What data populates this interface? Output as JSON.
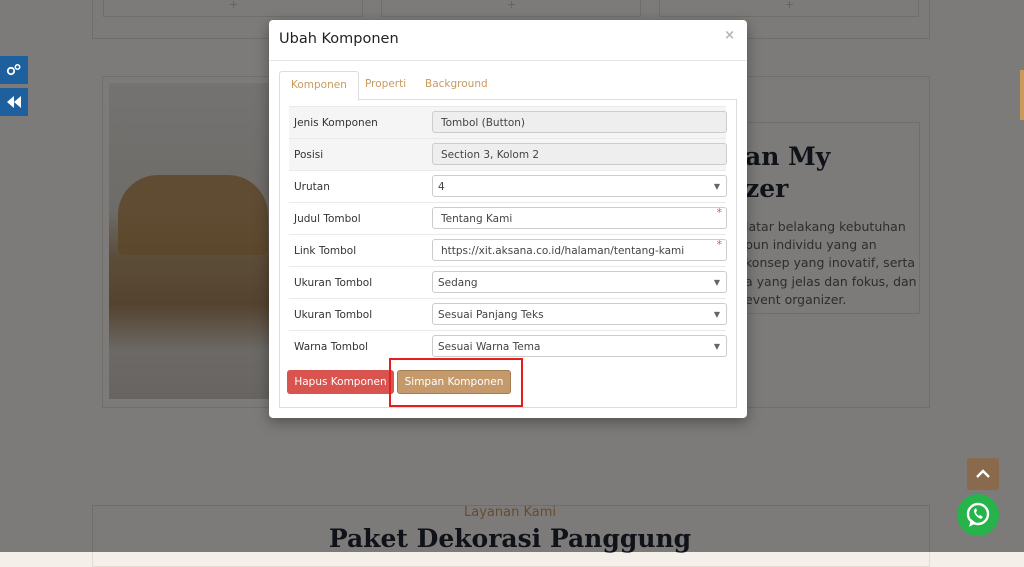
{
  "background": {
    "heading_line1": "an My",
    "heading_line2": "zer",
    "paragraph": "latar belakang kebutuhan pun individu yang an konsep yang inovatif, serta a yang jelas dan fokus, dan event organizer.",
    "section_subtitle": "Layanan Kami",
    "section_title": "Paket Dekorasi Panggung"
  },
  "modal": {
    "title": "Ubah Komponen",
    "close": "×",
    "tabs": [
      {
        "label": "Komponen",
        "active": true
      },
      {
        "label": "Properti",
        "active": false
      },
      {
        "label": "Background",
        "active": false
      }
    ],
    "rows": [
      {
        "label": "Jenis Komponen",
        "value": "Tombol (Button)"
      },
      {
        "label": "Posisi",
        "value": "Section 3, Kolom 2"
      },
      {
        "label": "Urutan",
        "value": "4"
      },
      {
        "label": "Judul Tombol",
        "value": "Tentang Kami"
      },
      {
        "label": "Link Tombol",
        "value": "https://xit.aksana.co.id/halaman/tentang-kami"
      },
      {
        "label": "Ukuran Tombol",
        "value": "Sedang"
      },
      {
        "label": "Ukuran Tombol",
        "value": "Sesuai Panjang Teks"
      },
      {
        "label": "Warna Tombol",
        "value": "Sesuai Warna Tema"
      }
    ],
    "required_mark": "*",
    "delete_label": "Hapus Komponen",
    "save_label": "Simpan Komponen"
  },
  "icons": {
    "settings": "gears-icon",
    "collapse": "double-left-arrow-icon",
    "scroll_top": "chevron-up-icon",
    "whatsapp": "whatsapp-icon"
  },
  "colors": {
    "accent": "#c89a5e",
    "danger": "#d9534f",
    "save": "#c49a6c",
    "side_buttons": "#1e5f9e",
    "highlight": "#e51d1d"
  }
}
